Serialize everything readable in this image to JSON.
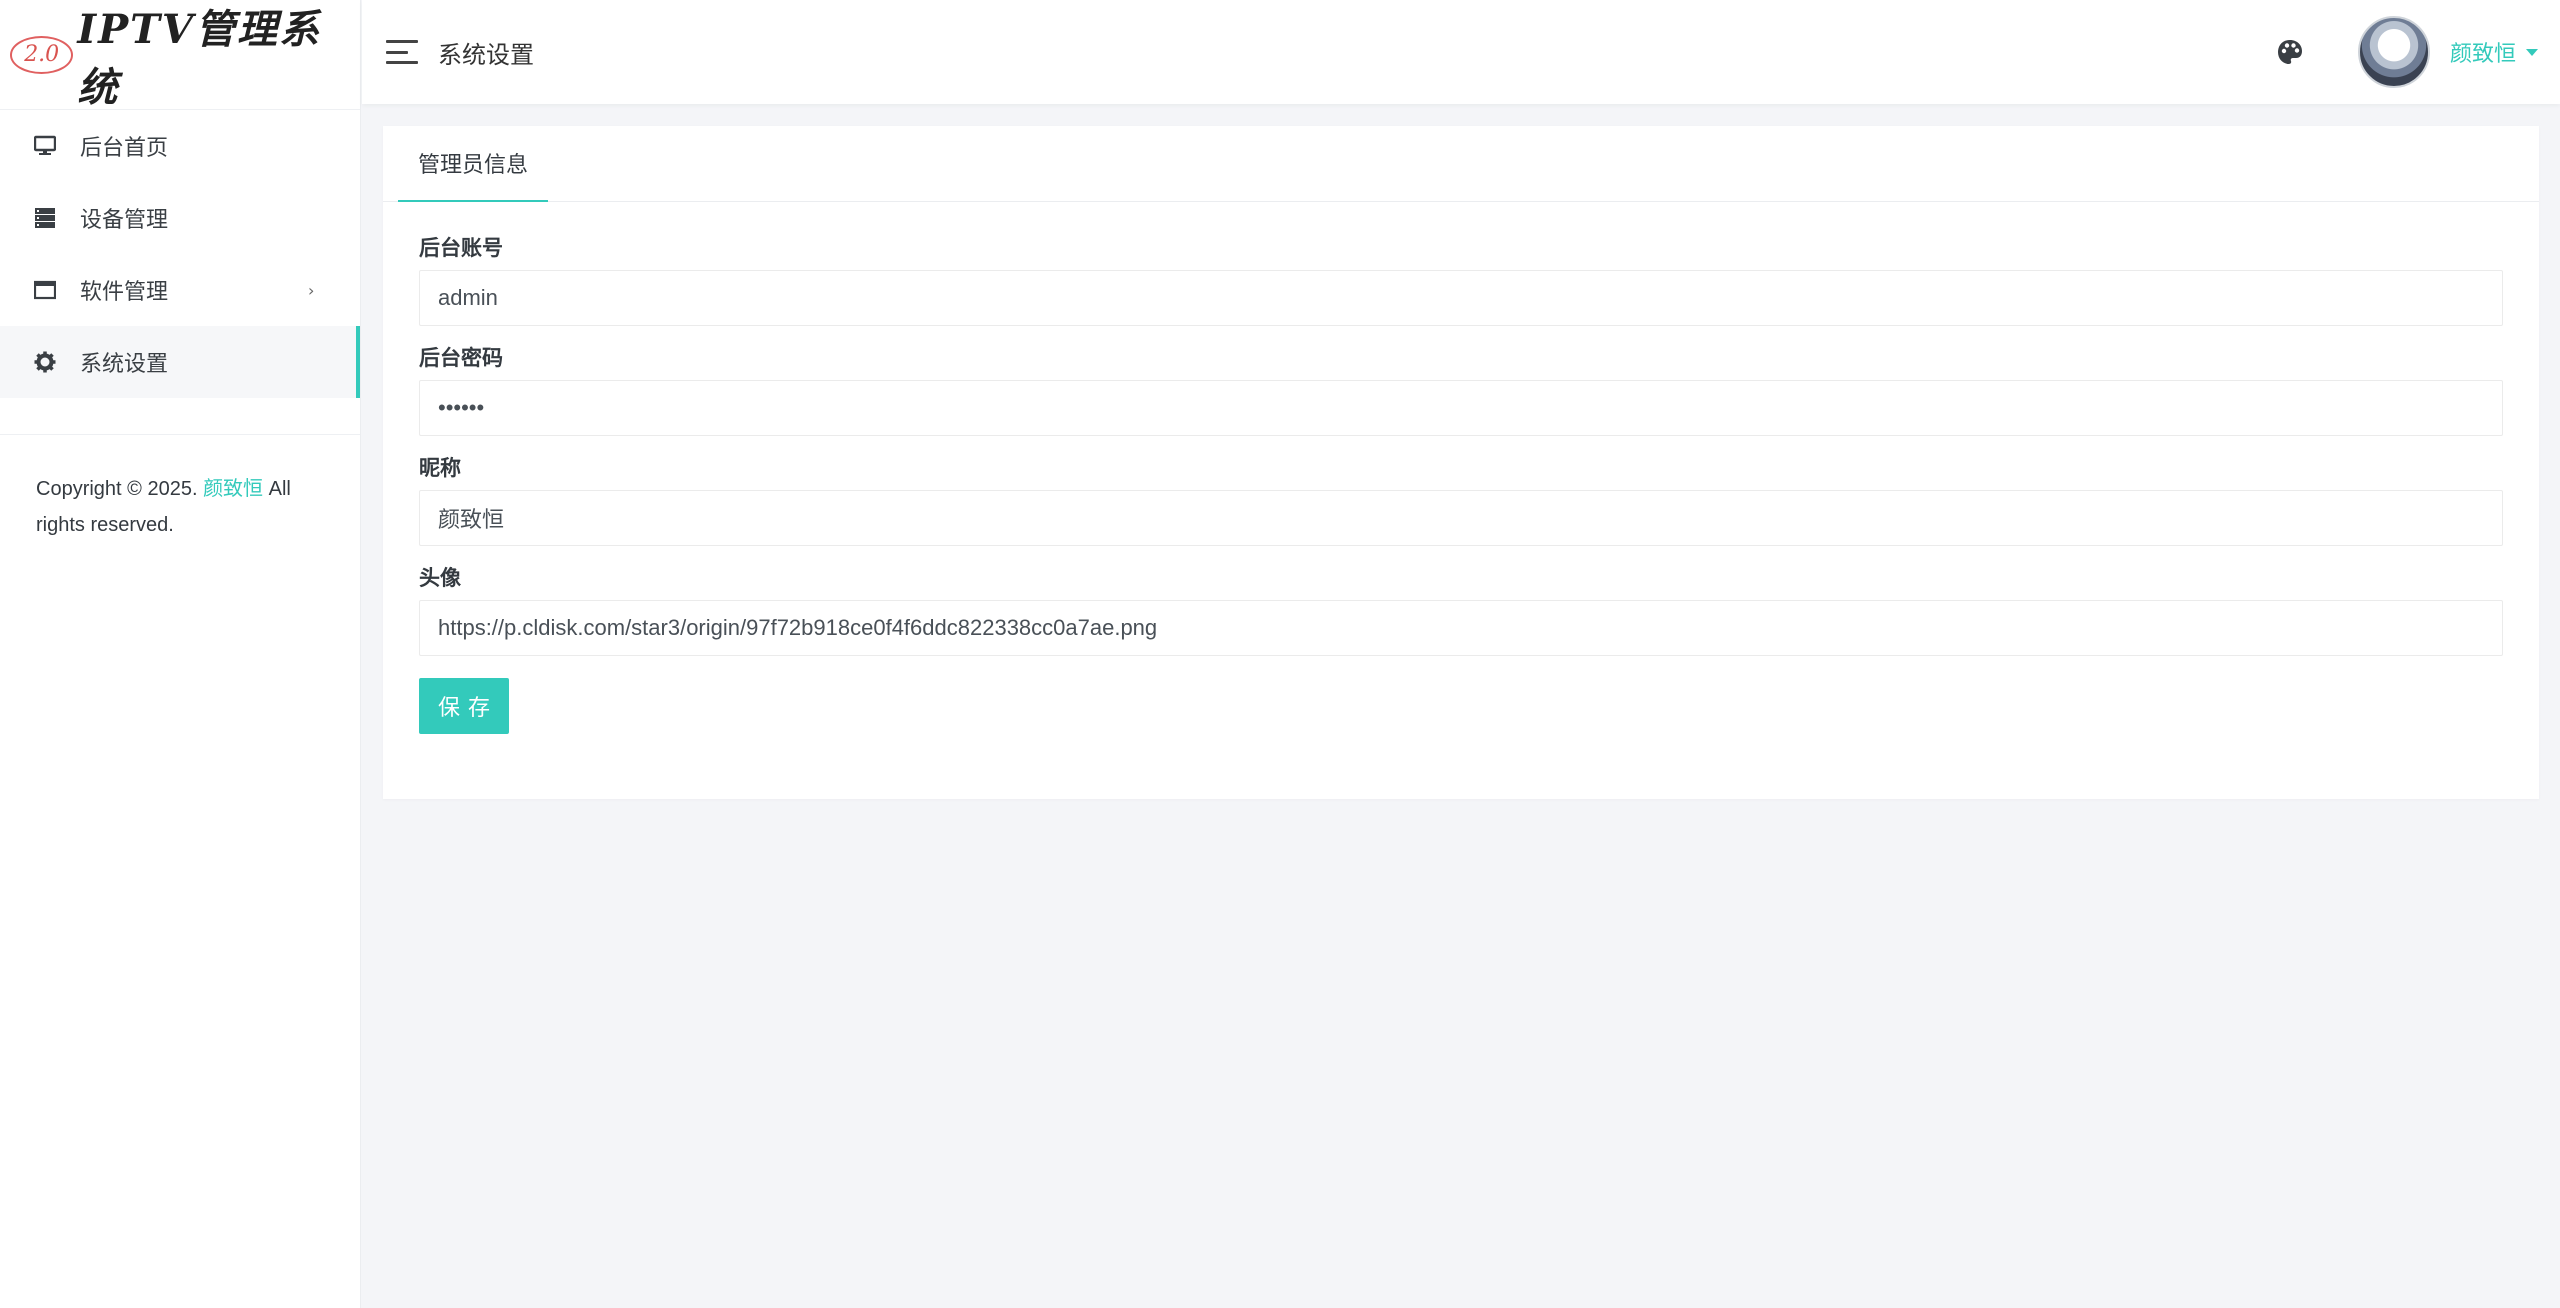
{
  "logo": {
    "badge": "2.0",
    "text": "IPTV管理系统"
  },
  "sidebar": {
    "items": [
      {
        "label": "后台首页",
        "icon": "monitor-icon"
      },
      {
        "label": "设备管理",
        "icon": "server-icon"
      },
      {
        "label": "软件管理",
        "icon": "window-icon",
        "chevron": "›"
      },
      {
        "label": "系统设置",
        "icon": "gear-icon",
        "active": true
      }
    ],
    "copyright_prefix": "Copyright © 2025. ",
    "copyright_author": "颜致恒",
    "copyright_suffix": " All rights reserved."
  },
  "header": {
    "title": "系统设置",
    "username": "颜致恒"
  },
  "card": {
    "tab_label": "管理员信息",
    "fields": {
      "account": {
        "label": "后台账号",
        "value": "admin"
      },
      "password": {
        "label": "后台密码",
        "value": "••••••"
      },
      "nickname": {
        "label": "昵称",
        "value": "颜致恒"
      },
      "avatar": {
        "label": "头像",
        "value": "https://p.cldisk.com/star3/origin/97f72b918ce0f4f6ddc822338cc0a7ae.png"
      }
    },
    "save_label": "保存"
  },
  "colors": {
    "accent": "#33cabb",
    "background": "#f4f5f8"
  }
}
